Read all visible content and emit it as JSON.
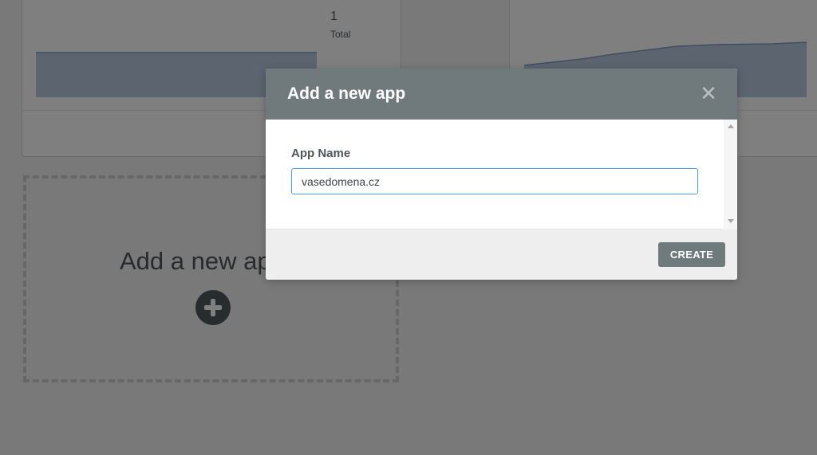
{
  "background": {
    "stat_value": "1",
    "stat_label": "Total",
    "stat_partial": "",
    "add_card_text": "Add a new app",
    "add_card_icon": "plus-circle-icon"
  },
  "modal": {
    "title": "Add a new app",
    "close_icon": "close-icon",
    "field_label": "App Name",
    "app_name_value": "vasedomena.cz",
    "create_label": "CREATE"
  },
  "colors": {
    "header": "#707a7c",
    "button": "#6f7a7d",
    "input_focus_border": "#4aa1d6",
    "chart_fill": "#b9c9de",
    "chart_line": "#7f9cc0"
  }
}
